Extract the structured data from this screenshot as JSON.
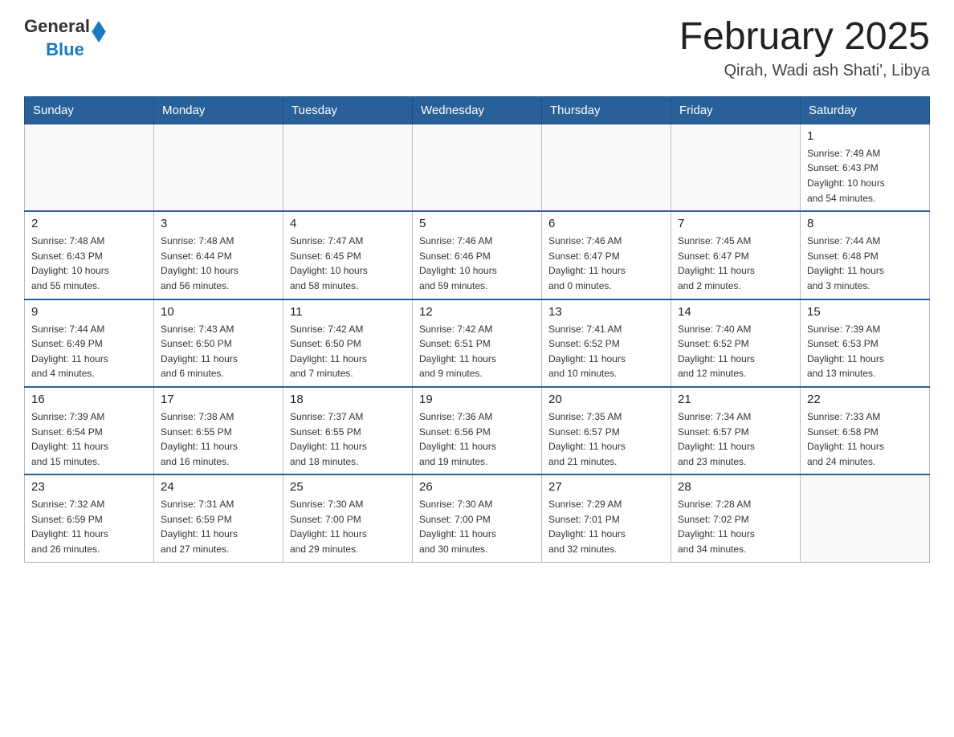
{
  "header": {
    "logo_general": "General",
    "logo_blue": "Blue",
    "month_title": "February 2025",
    "location": "Qirah, Wadi ash Shati', Libya"
  },
  "days_of_week": [
    "Sunday",
    "Monday",
    "Tuesday",
    "Wednesday",
    "Thursday",
    "Friday",
    "Saturday"
  ],
  "weeks": [
    [
      {
        "day": "",
        "info": ""
      },
      {
        "day": "",
        "info": ""
      },
      {
        "day": "",
        "info": ""
      },
      {
        "day": "",
        "info": ""
      },
      {
        "day": "",
        "info": ""
      },
      {
        "day": "",
        "info": ""
      },
      {
        "day": "1",
        "info": "Sunrise: 7:49 AM\nSunset: 6:43 PM\nDaylight: 10 hours\nand 54 minutes."
      }
    ],
    [
      {
        "day": "2",
        "info": "Sunrise: 7:48 AM\nSunset: 6:43 PM\nDaylight: 10 hours\nand 55 minutes."
      },
      {
        "day": "3",
        "info": "Sunrise: 7:48 AM\nSunset: 6:44 PM\nDaylight: 10 hours\nand 56 minutes."
      },
      {
        "day": "4",
        "info": "Sunrise: 7:47 AM\nSunset: 6:45 PM\nDaylight: 10 hours\nand 58 minutes."
      },
      {
        "day": "5",
        "info": "Sunrise: 7:46 AM\nSunset: 6:46 PM\nDaylight: 10 hours\nand 59 minutes."
      },
      {
        "day": "6",
        "info": "Sunrise: 7:46 AM\nSunset: 6:47 PM\nDaylight: 11 hours\nand 0 minutes."
      },
      {
        "day": "7",
        "info": "Sunrise: 7:45 AM\nSunset: 6:47 PM\nDaylight: 11 hours\nand 2 minutes."
      },
      {
        "day": "8",
        "info": "Sunrise: 7:44 AM\nSunset: 6:48 PM\nDaylight: 11 hours\nand 3 minutes."
      }
    ],
    [
      {
        "day": "9",
        "info": "Sunrise: 7:44 AM\nSunset: 6:49 PM\nDaylight: 11 hours\nand 4 minutes."
      },
      {
        "day": "10",
        "info": "Sunrise: 7:43 AM\nSunset: 6:50 PM\nDaylight: 11 hours\nand 6 minutes."
      },
      {
        "day": "11",
        "info": "Sunrise: 7:42 AM\nSunset: 6:50 PM\nDaylight: 11 hours\nand 7 minutes."
      },
      {
        "day": "12",
        "info": "Sunrise: 7:42 AM\nSunset: 6:51 PM\nDaylight: 11 hours\nand 9 minutes."
      },
      {
        "day": "13",
        "info": "Sunrise: 7:41 AM\nSunset: 6:52 PM\nDaylight: 11 hours\nand 10 minutes."
      },
      {
        "day": "14",
        "info": "Sunrise: 7:40 AM\nSunset: 6:52 PM\nDaylight: 11 hours\nand 12 minutes."
      },
      {
        "day": "15",
        "info": "Sunrise: 7:39 AM\nSunset: 6:53 PM\nDaylight: 11 hours\nand 13 minutes."
      }
    ],
    [
      {
        "day": "16",
        "info": "Sunrise: 7:39 AM\nSunset: 6:54 PM\nDaylight: 11 hours\nand 15 minutes."
      },
      {
        "day": "17",
        "info": "Sunrise: 7:38 AM\nSunset: 6:55 PM\nDaylight: 11 hours\nand 16 minutes."
      },
      {
        "day": "18",
        "info": "Sunrise: 7:37 AM\nSunset: 6:55 PM\nDaylight: 11 hours\nand 18 minutes."
      },
      {
        "day": "19",
        "info": "Sunrise: 7:36 AM\nSunset: 6:56 PM\nDaylight: 11 hours\nand 19 minutes."
      },
      {
        "day": "20",
        "info": "Sunrise: 7:35 AM\nSunset: 6:57 PM\nDaylight: 11 hours\nand 21 minutes."
      },
      {
        "day": "21",
        "info": "Sunrise: 7:34 AM\nSunset: 6:57 PM\nDaylight: 11 hours\nand 23 minutes."
      },
      {
        "day": "22",
        "info": "Sunrise: 7:33 AM\nSunset: 6:58 PM\nDaylight: 11 hours\nand 24 minutes."
      }
    ],
    [
      {
        "day": "23",
        "info": "Sunrise: 7:32 AM\nSunset: 6:59 PM\nDaylight: 11 hours\nand 26 minutes."
      },
      {
        "day": "24",
        "info": "Sunrise: 7:31 AM\nSunset: 6:59 PM\nDaylight: 11 hours\nand 27 minutes."
      },
      {
        "day": "25",
        "info": "Sunrise: 7:30 AM\nSunset: 7:00 PM\nDaylight: 11 hours\nand 29 minutes."
      },
      {
        "day": "26",
        "info": "Sunrise: 7:30 AM\nSunset: 7:00 PM\nDaylight: 11 hours\nand 30 minutes."
      },
      {
        "day": "27",
        "info": "Sunrise: 7:29 AM\nSunset: 7:01 PM\nDaylight: 11 hours\nand 32 minutes."
      },
      {
        "day": "28",
        "info": "Sunrise: 7:28 AM\nSunset: 7:02 PM\nDaylight: 11 hours\nand 34 minutes."
      },
      {
        "day": "",
        "info": ""
      }
    ]
  ]
}
